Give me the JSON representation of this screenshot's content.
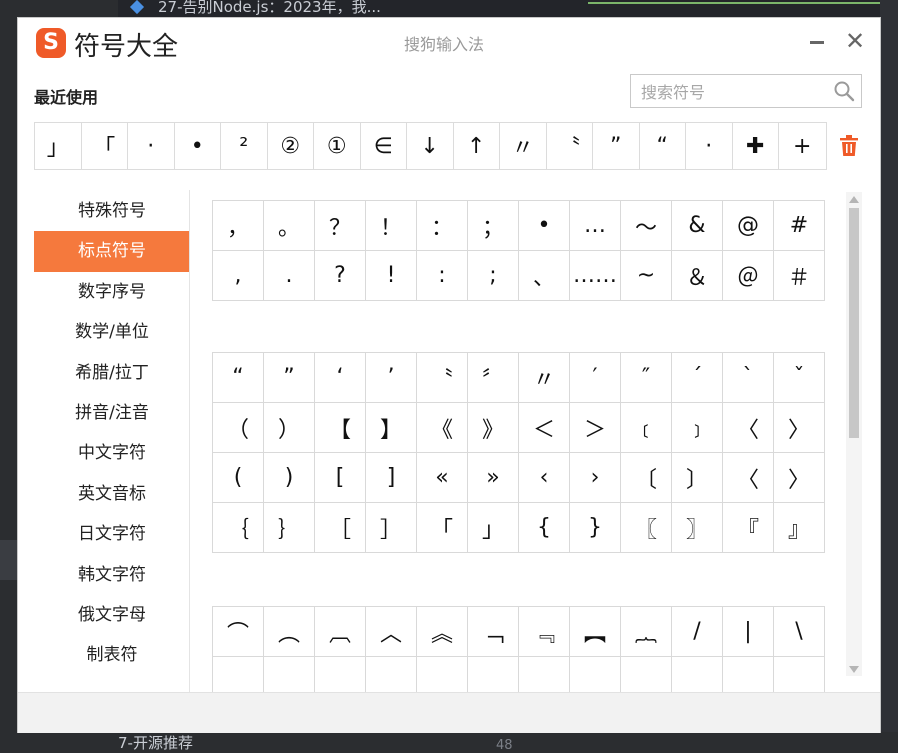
{
  "background": {
    "top_text": "27-告别Node.js：2023年，我...",
    "bottom_text": "7-开源推荐",
    "bottom_number": "48"
  },
  "dialog": {
    "logo_letter": "S",
    "app_name": "符号大全",
    "subtitle": "搜狗输入法",
    "recent_label": "最近使用",
    "search_placeholder": "搜索符号",
    "recent_symbols": [
      "」",
      "「",
      "·",
      "•",
      "²",
      "②",
      "①",
      "∈",
      "↓",
      "↑",
      "〃",
      "〝",
      "”",
      "“",
      "·",
      "✚",
      "+"
    ]
  },
  "categories": [
    {
      "label": "特殊符号",
      "active": false
    },
    {
      "label": "标点符号",
      "active": true
    },
    {
      "label": "数字序号",
      "active": false
    },
    {
      "label": "数学/单位",
      "active": false
    },
    {
      "label": "希腊/拉丁",
      "active": false
    },
    {
      "label": "拼音/注音",
      "active": false
    },
    {
      "label": "中文字符",
      "active": false
    },
    {
      "label": "英文音标",
      "active": false
    },
    {
      "label": "日文字符",
      "active": false
    },
    {
      "label": "韩文字符",
      "active": false
    },
    {
      "label": "俄文字母",
      "active": false
    },
    {
      "label": "制表符",
      "active": false
    }
  ],
  "symbol_groups": [
    {
      "rows": [
        [
          "，",
          "。",
          "？",
          "！",
          "：",
          "；",
          "•",
          "…",
          "～",
          "&",
          "@",
          "#"
        ],
        [
          ",",
          ".",
          "?",
          "!",
          ":",
          ";",
          "、",
          "……",
          "~",
          "＆",
          "＠",
          "＃"
        ]
      ]
    },
    {
      "rows": [
        [
          "“",
          "”",
          "‘",
          "’",
          "〝",
          "〞",
          "〃",
          "′",
          "″",
          "ˊ",
          "ˋ",
          "ˇ"
        ],
        [
          "（",
          "）",
          "【",
          "】",
          "《",
          "》",
          "＜",
          "＞",
          "﹝",
          "﹞",
          "〈",
          "〉"
        ],
        [
          "(",
          ")",
          "[",
          "]",
          "«",
          "»",
          "‹",
          "›",
          "〔",
          "〕",
          "〈",
          "〉"
        ],
        [
          "｛",
          "｝",
          "［",
          "］",
          "「",
          "」",
          "{",
          "}",
          "〖",
          "〗",
          "『",
          "』"
        ]
      ]
    },
    {
      "rows": [
        [
          "⌒",
          "︵",
          "︹",
          "︿",
          "︽",
          "﹁",
          "﹃",
          "︻",
          "︷",
          "/",
          "|",
          "\\"
        ],
        [
          "",
          "",
          "",
          "",
          "",
          "",
          "",
          "",
          "",
          "",
          "",
          ""
        ]
      ]
    }
  ],
  "colors": {
    "accent": "#f5793d",
    "logo": "#ef5a28",
    "trash": "#ef5a28"
  }
}
